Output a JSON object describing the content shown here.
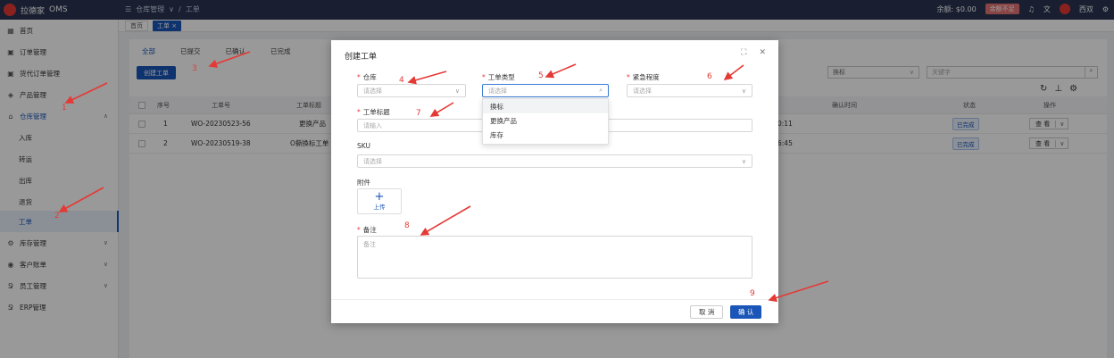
{
  "topbar": {
    "logo_text": "拉德家",
    "app_name": "OMS",
    "breadcrumb_1": "仓库管理",
    "breadcrumb_sep": "/",
    "breadcrumb_2": "工单",
    "balance": "余额: $0.00",
    "balance_warning": "余额不足",
    "user_name": "西双"
  },
  "sidebar": {
    "items": [
      {
        "label": "首页",
        "icon": "home-icon"
      },
      {
        "label": "订单管理",
        "icon": "order-icon"
      },
      {
        "label": "货代订单管理",
        "icon": "forwarder-icon"
      },
      {
        "label": "产品管理",
        "icon": "product-icon"
      },
      {
        "label": "仓库管理",
        "icon": "warehouse-icon"
      },
      {
        "label": "入库"
      },
      {
        "label": "转运"
      },
      {
        "label": "出库"
      },
      {
        "label": "退货"
      },
      {
        "label": "工单"
      },
      {
        "label": "库存管理",
        "icon": "inventory-icon"
      },
      {
        "label": "客户账单",
        "icon": "bill-icon"
      },
      {
        "label": "员工管理",
        "icon": "staff-icon"
      },
      {
        "label": "ERP管理",
        "icon": "erp-icon"
      }
    ]
  },
  "tabs": {
    "home": "首页",
    "current": "工单 ×"
  },
  "status_tabs": [
    "全部",
    "已提交",
    "已确认",
    "已完成"
  ],
  "main": {
    "create_button": "创建工单",
    "filter_select": "換标",
    "search_placeholder": "关键字"
  },
  "table": {
    "headers": {
      "index": "序号",
      "no": "工单号",
      "title": "工单标题",
      "confirm_time": "确认时间",
      "status": "状态",
      "action": "操作"
    },
    "rows": [
      {
        "index": "1",
        "no": "WO-20230523-56",
        "title": "更换产品",
        "time": "0:11",
        "status": "已完成",
        "action": "查 看"
      },
      {
        "index": "2",
        "no": "WO-20230519-38",
        "title": "O撕換标工单",
        "time": "6:45",
        "status": "已完成",
        "action": "查 看"
      }
    ]
  },
  "modal": {
    "title": "创建工单",
    "warehouse_label": "仓库",
    "warehouse_placeholder": "请选择",
    "type_label": "工单类型",
    "type_placeholder": "请选择",
    "urgency_label": "紧急程度",
    "urgency_placeholder": "请选择",
    "title_label": "工单标题",
    "title_placeholder": "请输入",
    "sku_label": "SKU",
    "sku_placeholder": "请选择",
    "attachment_label": "附件",
    "upload_label": "上传",
    "remark_label": "备注",
    "remark_placeholder": "备注",
    "type_options": [
      "換标",
      "更换产品",
      "库存"
    ],
    "cancel_button": "取 消",
    "confirm_button": "确 认"
  },
  "annotations": [
    "1",
    "2",
    "3",
    "4",
    "5",
    "6",
    "7",
    "8",
    "9"
  ]
}
